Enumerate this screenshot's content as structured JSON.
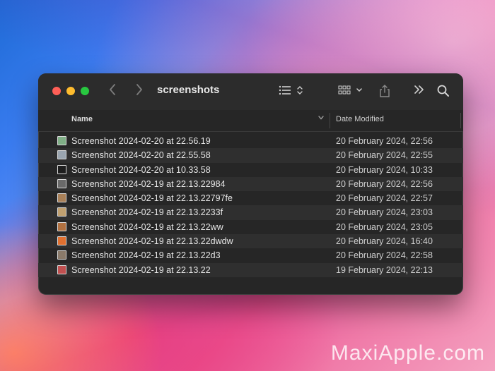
{
  "window": {
    "title": "screenshots"
  },
  "toolbar": {
    "back_icon": "chevron-left-icon",
    "forward_icon": "chevron-right-icon",
    "list_view_icon": "list-view-icon",
    "group_icon": "group-grid-icon",
    "share_icon": "share-icon",
    "more_icon": "double-chevron-icon",
    "search_icon": "magnifier-icon"
  },
  "columns": {
    "name": "Name",
    "date": "Date Modified"
  },
  "files": [
    {
      "name": "Screenshot 2024-02-20 at 22.56.19",
      "date": "20 February 2024, 22:56",
      "thumb": "#7fae86"
    },
    {
      "name": "Screenshot 2024-02-20 at 22.55.58",
      "date": "20 February 2024, 22:55",
      "thumb": "#9aa5b0"
    },
    {
      "name": "Screenshot 2024-02-20 at 10.33.58",
      "date": "20 February 2024, 10:33",
      "thumb": "#1e1e1e"
    },
    {
      "name": "Screenshot 2024-02-19 at 22.13.22984",
      "date": "20 February 2024, 22:56",
      "thumb": "#6a6a6a"
    },
    {
      "name": "Screenshot 2024-02-19 at 22.13.22797fe",
      "date": "20 February 2024, 22:57",
      "thumb": "#a88058"
    },
    {
      "name": "Screenshot 2024-02-19 at 22.13.2233f",
      "date": "20 February 2024, 23:03",
      "thumb": "#c0a070"
    },
    {
      "name": "Screenshot 2024-02-19 at 22.13.22ww",
      "date": "20 February 2024, 23:05",
      "thumb": "#b07040"
    },
    {
      "name": "Screenshot 2024-02-19 at 22.13.22dwdw",
      "date": "20 February 2024, 16:40",
      "thumb": "#e07030"
    },
    {
      "name": "Screenshot 2024-02-19 at 22.13.22d3",
      "date": "20 February 2024, 22:58",
      "thumb": "#8a7a6a"
    },
    {
      "name": "Screenshot 2024-02-19 at 22.13.22",
      "date": "19 February 2024, 22:13",
      "thumb": "#c05050"
    }
  ],
  "watermark": "MaxiApple.com"
}
